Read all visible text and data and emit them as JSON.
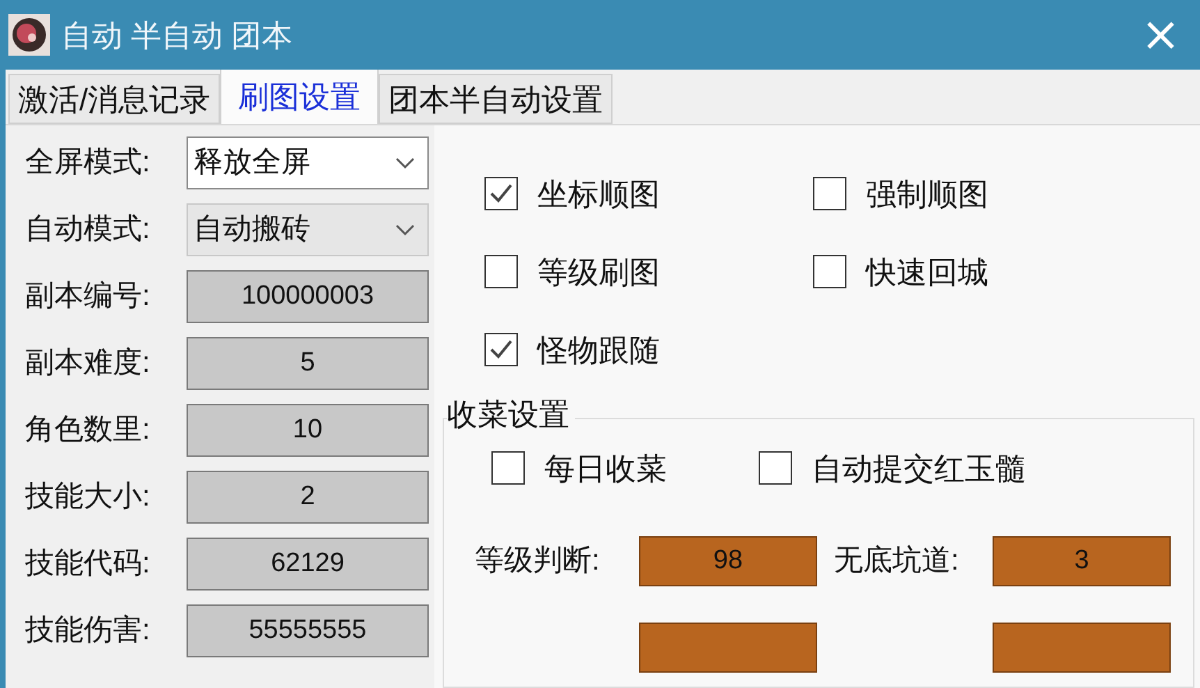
{
  "window": {
    "title": "自动 半自动 团本",
    "close": "×"
  },
  "tabs": [
    {
      "label": "激活/消息记录",
      "selected": false
    },
    {
      "label": "刷图设置",
      "selected": true
    },
    {
      "label": "团本半自动设置",
      "selected": false
    }
  ],
  "left_fields": [
    {
      "kind": "dropdown",
      "label": "全屏模式:",
      "value": "释放全屏",
      "disabled": false
    },
    {
      "kind": "dropdown",
      "label": "自动模式:",
      "value": "自动搬砖",
      "disabled": true
    },
    {
      "kind": "number",
      "label": "副本编号:",
      "value": "100000003"
    },
    {
      "kind": "number",
      "label": "副本难度:",
      "value": "5"
    },
    {
      "kind": "number",
      "label": "角色数里:",
      "value": "10"
    },
    {
      "kind": "number",
      "label": "技能大小:",
      "value": "2"
    },
    {
      "kind": "number",
      "label": "技能代码:",
      "value": "62129"
    },
    {
      "kind": "number",
      "label": "技能伤害:",
      "value": "55555555"
    }
  ],
  "options": [
    {
      "label": "坐标顺图",
      "checked": true
    },
    {
      "label": "强制顺图",
      "checked": false
    },
    {
      "label": "等级刷图",
      "checked": false
    },
    {
      "label": "快速回城",
      "checked": false
    },
    {
      "label": "怪物跟随",
      "checked": true
    }
  ],
  "harvest_group": {
    "title": "收菜设置",
    "options": [
      {
        "label": "每日收菜",
        "checked": false
      },
      {
        "label": "自动提交红玉髓",
        "checked": false
      }
    ],
    "fields": [
      {
        "kind": "labeled",
        "label": "等级判断:",
        "value": "98"
      },
      {
        "kind": "labeled",
        "label": "无底坑道:",
        "value": "3"
      },
      {
        "kind": "cut_off"
      },
      {
        "kind": "cut_off"
      }
    ]
  }
}
